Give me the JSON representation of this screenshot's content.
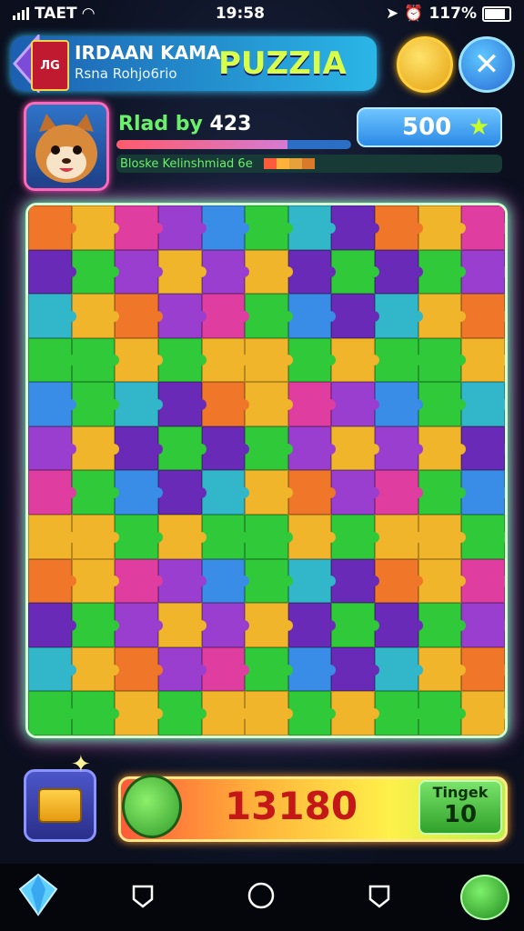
{
  "status_bar": {
    "carrier": "TAET",
    "time": "19:58",
    "battery_pct": "117%"
  },
  "header": {
    "title_prefix": "IRDAAN KAMA",
    "title_main": "PUZZIA",
    "subtitle": "Rsna Rohjo6rio",
    "logo_text": "ЛG"
  },
  "player": {
    "level_label": "Rlad by",
    "level_value": "423",
    "level_progress": 0.73,
    "sub_label": "Bloske Kelinshmiad 6e",
    "score": "500"
  },
  "board": {
    "columns": 11,
    "rows": 12,
    "palette": [
      "#f0762a",
      "#2fc93a",
      "#e03da0",
      "#6a2ab8",
      "#3a8de6",
      "#f0b52a",
      "#31b7c9",
      "#9a3ed0"
    ]
  },
  "footer": {
    "total": "13180",
    "tingek_label": "Tingek",
    "tingek_value": "10"
  },
  "colors": {
    "accent_green": "#6bf06b",
    "title_yellow": "#d8ff4a",
    "total_red": "#c41818"
  }
}
